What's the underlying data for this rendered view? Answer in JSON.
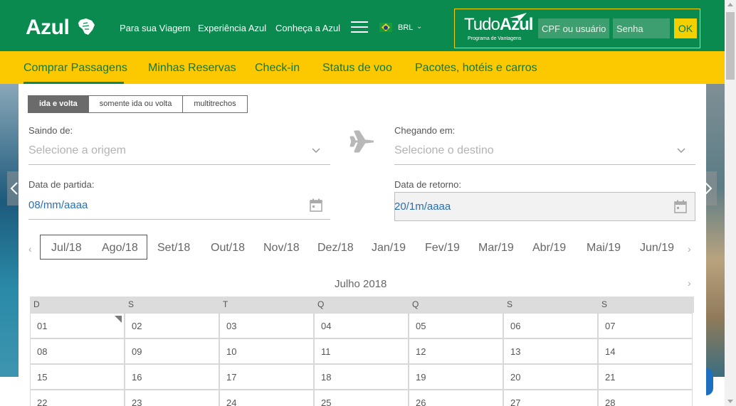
{
  "header": {
    "logo": "Azul",
    "nav": [
      "Para sua Viagem",
      "Experiência Azul",
      "Conheça a Azul"
    ],
    "currency": "BRL",
    "loyalty": {
      "brand_light": "Tudo",
      "brand_bold": "Azul",
      "subtitle": "Programa de Vantagens",
      "user_placeholder": "CPF ou usuário",
      "password_placeholder": "Senha",
      "ok_label": "OK"
    }
  },
  "subnav": [
    "Comprar Passagens",
    "Minhas Reservas",
    "Check-in",
    "Status de voo",
    "Pacotes, hotéis e carros"
  ],
  "booking": {
    "trip_types": [
      "ida e volta",
      "somente ida ou volta",
      "multitrechos"
    ],
    "origin_label": "Saindo de:",
    "origin_placeholder": "Selecione a origem",
    "destination_label": "Chegando em:",
    "destination_placeholder": "Selecione o destino",
    "departure_label": "Data de partida:",
    "departure_value": "08/mm/aaaa",
    "return_label": "Data de retorno:",
    "return_value": "20/1m/aaaa"
  },
  "calendar": {
    "months": [
      "Jul/18",
      "Ago/18",
      "Set/18",
      "Out/18",
      "Nov/18",
      "Dez/18",
      "Jan/19",
      "Fev/19",
      "Mar/19",
      "Abr/19",
      "Mai/19",
      "Jun/19"
    ],
    "title": "Julho 2018",
    "weekdays": [
      "D",
      "S",
      "T",
      "Q",
      "Q",
      "S",
      "S"
    ],
    "days": [
      [
        "01",
        "02",
        "03",
        "04",
        "05",
        "06",
        "07"
      ],
      [
        "08",
        "09",
        "10",
        "11",
        "12",
        "13",
        "14"
      ],
      [
        "15",
        "16",
        "17",
        "18",
        "19",
        "20",
        "21"
      ],
      [
        "22",
        "23",
        "24",
        "25",
        "26",
        "27",
        "28"
      ]
    ]
  },
  "colors": {
    "brand_green": "#0a8a4e",
    "brand_yellow": "#fcc900",
    "link_blue": "#2a6fb0"
  }
}
